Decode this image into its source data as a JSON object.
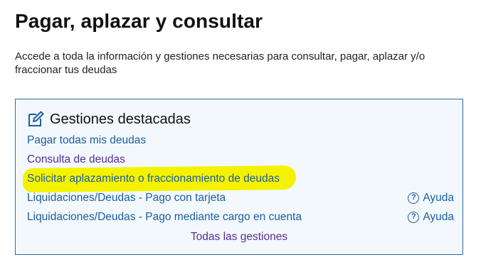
{
  "header": {
    "title": "Pagar, aplazar y consultar",
    "intro": "Accede a toda la información y gestiones necesarias para consultar, pagar, aplazar y/o fraccionar tus deudas"
  },
  "panel": {
    "icon": "edit-icon",
    "title": "Gestiones destacadas",
    "links": [
      {
        "label": "Pagar todas mis deudas",
        "state": "unvisited"
      },
      {
        "label": "Consulta de deudas",
        "state": "visited"
      },
      {
        "label": "Solicitar aplazamiento o fraccionamiento de deudas",
        "state": "unvisited",
        "highlighted": true
      },
      {
        "label": "Liquidaciones/Deudas - Pago con tarjeta",
        "state": "unvisited",
        "help": "Ayuda"
      },
      {
        "label": "Liquidaciones/Deudas - Pago mediante cargo en cuenta",
        "state": "unvisited",
        "help": "Ayuda"
      }
    ],
    "all_label": "Todas las gestiones"
  },
  "colors": {
    "link": "#1a5fa0",
    "visited": "#5a2d91",
    "highlight": "#f5f200",
    "panel_bg": "#f3f8fc",
    "panel_border": "#2b6a99"
  }
}
